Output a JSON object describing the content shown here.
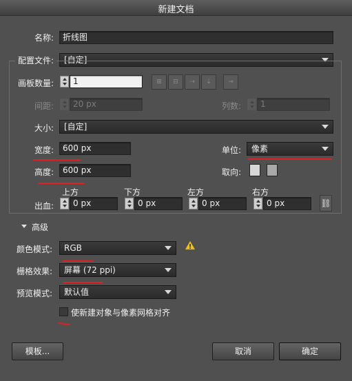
{
  "window": {
    "title": "新建文档"
  },
  "name": {
    "label": "名称:",
    "value": "折线图"
  },
  "profile": {
    "label": "配置文件:",
    "value": "[自定]"
  },
  "artboards": {
    "count_label": "画板数量:",
    "count_value": "1",
    "spacing_label": "间距:",
    "spacing_value": "20 px",
    "columns_label": "列数:",
    "columns_value": "1"
  },
  "size": {
    "label": "大小:",
    "value": "[自定]"
  },
  "width": {
    "label": "宽度:",
    "value": "600 px"
  },
  "height": {
    "label": "高度:",
    "value": "600 px"
  },
  "units": {
    "label": "单位:",
    "value": "像素"
  },
  "orientation": {
    "label": "取向:"
  },
  "bleed": {
    "label": "出血:",
    "top_label": "上方",
    "top_value": "0 px",
    "bottom_label": "下方",
    "bottom_value": "0 px",
    "left_label": "左方",
    "left_value": "0 px",
    "right_label": "右方",
    "right_value": "0 px"
  },
  "advanced": {
    "label": "高级",
    "color_mode_label": "颜色模式:",
    "color_mode_value": "RGB",
    "raster_label": "栅格效果:",
    "raster_value": "屏幕 (72 ppi)",
    "preview_label": "预览模式:",
    "preview_value": "默认值",
    "align_label": "使新建对象与像素网格对齐"
  },
  "buttons": {
    "templates": "模板...",
    "cancel": "取消",
    "ok": "确定"
  },
  "colors": {
    "annotation": "#e02020",
    "warning": "#f0c020",
    "background": "#505050"
  }
}
